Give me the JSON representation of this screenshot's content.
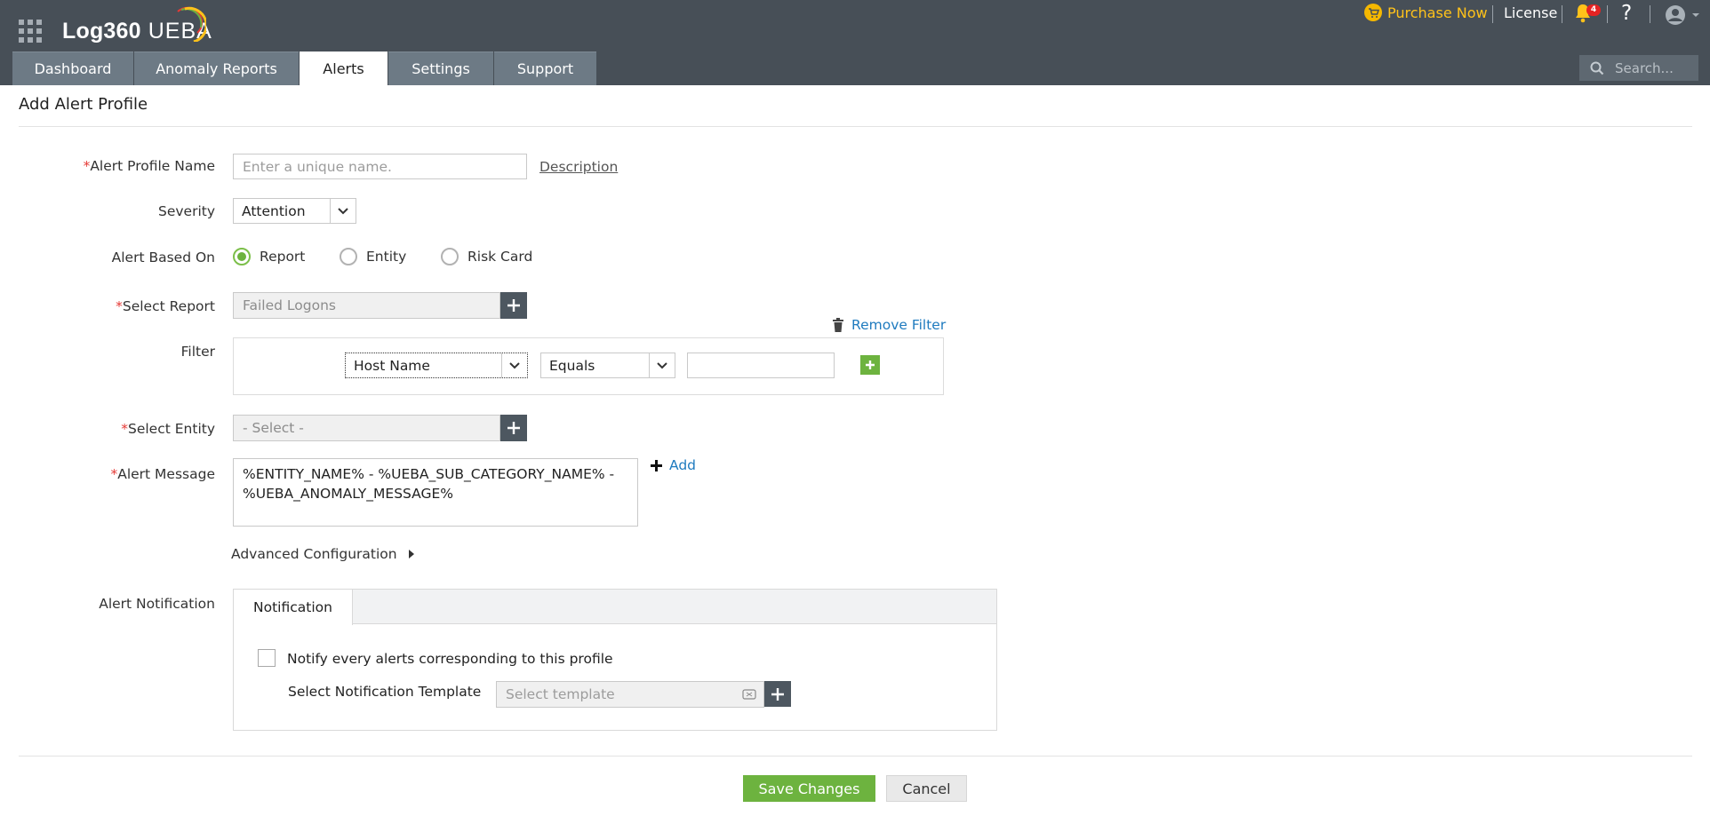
{
  "app": {
    "brand_primary": "Log360",
    "brand_secondary": "UEBA"
  },
  "header": {
    "purchase_label": "Purchase Now",
    "license_label": "License",
    "notification_count": "4",
    "help_label": "?",
    "search_placeholder": "Search..."
  },
  "tabs": [
    {
      "label": "Dashboard"
    },
    {
      "label": "Anomaly Reports"
    },
    {
      "label": "Alerts"
    },
    {
      "label": "Settings"
    },
    {
      "label": "Support"
    }
  ],
  "page": {
    "title": "Add Alert Profile"
  },
  "form": {
    "required_marker": "*",
    "profile_name_label": "Alert Profile Name",
    "profile_name_placeholder": "Enter a unique name.",
    "profile_name_value": "",
    "description_link": "Description",
    "severity_label": "Severity",
    "severity_value": "Attention",
    "based_on_label": "Alert Based On",
    "based_on_options": [
      {
        "label": "Report",
        "checked": true
      },
      {
        "label": "Entity",
        "checked": false
      },
      {
        "label": "Risk Card",
        "checked": false
      }
    ],
    "select_report_label": "Select Report",
    "select_report_value": "Failed Logons",
    "remove_filter_label": "Remove Filter",
    "filter_label": "Filter",
    "filter_field_value": "Host Name",
    "filter_operator_value": "Equals",
    "filter_value": "",
    "select_entity_label": "Select Entity",
    "select_entity_value": "- Select -",
    "alert_message_label": "Alert Message",
    "alert_message_value": "%ENTITY_NAME% - %UEBA_SUB_CATEGORY_NAME% - %UEBA_ANOMALY_MESSAGE%",
    "add_link": "Add",
    "advanced_config_label": "Advanced Configuration",
    "notification_label": "Alert Notification",
    "notification_tab": "Notification",
    "notify_every_label": "Notify every alerts corresponding to this profile",
    "template_label": "Select Notification Template",
    "template_placeholder": "Select template"
  },
  "actions": {
    "save_label": "Save Changes",
    "cancel_label": "Cancel"
  },
  "colors": {
    "header_bg": "#474f57",
    "tab_bg": "#6d7a85",
    "accent_green": "#6db33f",
    "link_blue": "#1f7bbf",
    "purchase_yellow": "#ffc21a",
    "required_red": "#e53935"
  }
}
